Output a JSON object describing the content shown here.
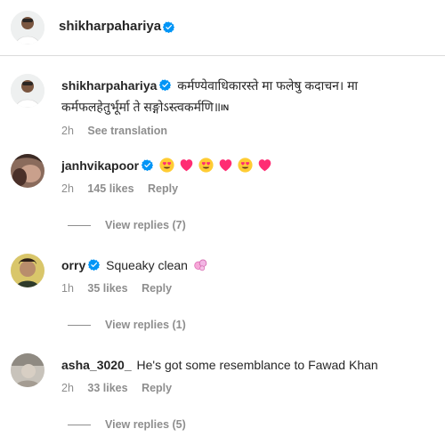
{
  "post": {
    "author": "shikharpahariya"
  },
  "caption": {
    "username": "shikharpahariya",
    "text_line1": "कर्मण्येवाधिकारस्ते मा फलेषु कदाचन। मा",
    "text_line2": "कर्मफलहेतुर्भूर्मा ते सङ्गोऽस्त्वकर्मणि॥",
    "flag": "IN",
    "time": "2h",
    "see_translation": "See translation"
  },
  "comments": [
    {
      "username": "janhvikapoor",
      "verified": true,
      "emojis": [
        "heart-eyes-emoji",
        "heart-emoji",
        "heart-eyes-emoji",
        "heart-emoji",
        "heart-eyes-emoji",
        "heart-emoji"
      ],
      "text": "",
      "time": "2h",
      "likes": "145 likes",
      "reply": "Reply",
      "view_replies": "View replies (7)"
    },
    {
      "username": "orry",
      "verified": true,
      "text": "Squeaky clean",
      "emojis": [
        "bubbles-emoji"
      ],
      "time": "1h",
      "likes": "35 likes",
      "reply": "Reply",
      "view_replies": "View replies (1)"
    },
    {
      "username": "asha_3020_",
      "verified": false,
      "text": "He's got some resemblance to Fawad Khan",
      "emojis": [],
      "time": "2h",
      "likes": "33 likes",
      "reply": "Reply",
      "view_replies": "View replies (5)"
    }
  ],
  "colors": {
    "verified_blue": "#0095f6",
    "heart_pink": "#ff2d73",
    "meta_gray": "#8e8e8e"
  }
}
